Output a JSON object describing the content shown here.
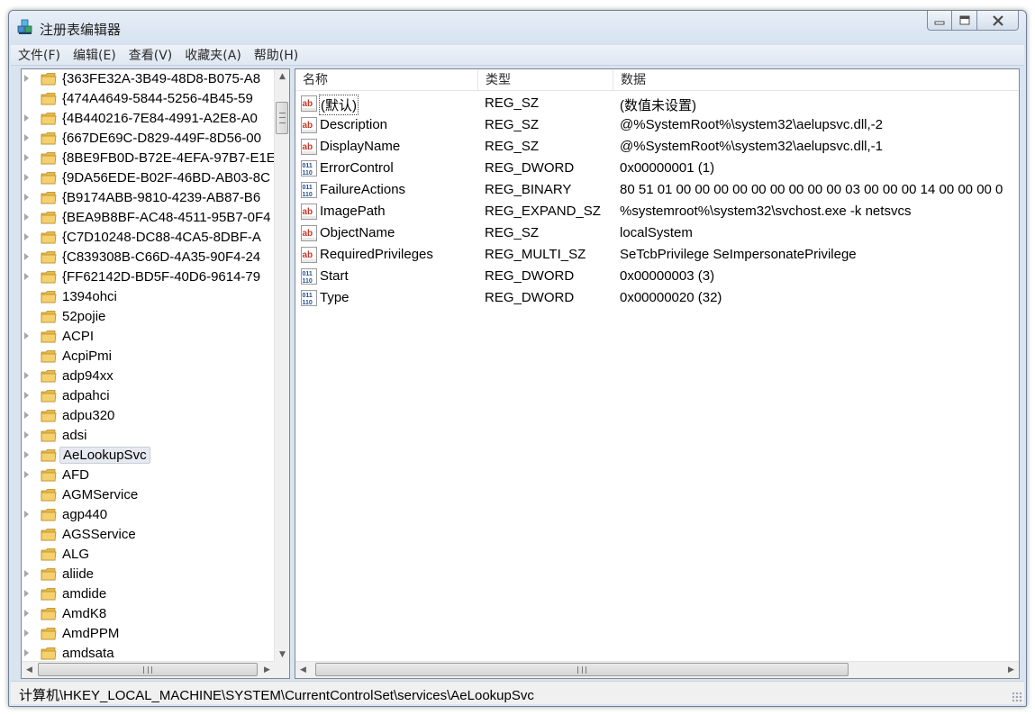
{
  "window": {
    "title": "注册表编辑器"
  },
  "caption": {
    "minimize_icon": "minimize-icon",
    "maximize_icon": "maximize-icon",
    "close_icon": "close-icon"
  },
  "menu": [
    "文件(F)",
    "编辑(E)",
    "查看(V)",
    "收藏夹(A)",
    "帮助(H)"
  ],
  "tree": {
    "items": [
      {
        "label": "{363FE32A-3B49-48D8-B075-A8",
        "expandable": true
      },
      {
        "label": "{474A4649-5844-5256-4B45-59",
        "expandable": false
      },
      {
        "label": "{4B440216-7E84-4991-A2E8-A0",
        "expandable": true
      },
      {
        "label": "{667DE69C-D829-449F-8D56-00",
        "expandable": true
      },
      {
        "label": "{8BE9FB0D-B72E-4EFA-97B7-E1E",
        "expandable": true
      },
      {
        "label": "{9DA56EDE-B02F-46BD-AB03-8C",
        "expandable": true
      },
      {
        "label": "{B9174ABB-9810-4239-AB87-B6",
        "expandable": true
      },
      {
        "label": "{BEA9B8BF-AC48-4511-95B7-0F4",
        "expandable": true
      },
      {
        "label": "{C7D10248-DC88-4CA5-8DBF-A",
        "expandable": true
      },
      {
        "label": "{C839308B-C66D-4A35-90F4-24",
        "expandable": true
      },
      {
        "label": "{FF62142D-BD5F-40D6-9614-79",
        "expandable": true
      },
      {
        "label": "1394ohci",
        "expandable": false
      },
      {
        "label": "52pojie",
        "expandable": false
      },
      {
        "label": "ACPI",
        "expandable": true
      },
      {
        "label": "AcpiPmi",
        "expandable": false
      },
      {
        "label": "adp94xx",
        "expandable": true
      },
      {
        "label": "adpahci",
        "expandable": true
      },
      {
        "label": "adpu320",
        "expandable": true
      },
      {
        "label": "adsi",
        "expandable": true
      },
      {
        "label": "AeLookupSvc",
        "expandable": true,
        "selected": true
      },
      {
        "label": "AFD",
        "expandable": true
      },
      {
        "label": "AGMService",
        "expandable": false
      },
      {
        "label": "agp440",
        "expandable": true
      },
      {
        "label": "AGSService",
        "expandable": false
      },
      {
        "label": "ALG",
        "expandable": false
      },
      {
        "label": "aliide",
        "expandable": true
      },
      {
        "label": "amdide",
        "expandable": true
      },
      {
        "label": "AmdK8",
        "expandable": true
      },
      {
        "label": "AmdPPM",
        "expandable": true
      },
      {
        "label": "amdsata",
        "expandable": true
      }
    ]
  },
  "list": {
    "columns": [
      "名称",
      "类型",
      "数据"
    ],
    "rows": [
      {
        "icon": "string-value-icon",
        "name": "(默认)",
        "type": "REG_SZ",
        "data": "(数值未设置)",
        "focused": true
      },
      {
        "icon": "string-value-icon",
        "name": "Description",
        "type": "REG_SZ",
        "data": "@%SystemRoot%\\system32\\aelupsvc.dll,-2"
      },
      {
        "icon": "string-value-icon",
        "name": "DisplayName",
        "type": "REG_SZ",
        "data": "@%SystemRoot%\\system32\\aelupsvc.dll,-1"
      },
      {
        "icon": "binary-value-icon",
        "name": "ErrorControl",
        "type": "REG_DWORD",
        "data": "0x00000001 (1)"
      },
      {
        "icon": "binary-value-icon",
        "name": "FailureActions",
        "type": "REG_BINARY",
        "data": "80 51 01 00 00 00 00 00 00 00 00 00 03 00 00 00 14 00 00 00 0"
      },
      {
        "icon": "string-value-icon",
        "name": "ImagePath",
        "type": "REG_EXPAND_SZ",
        "data": "%systemroot%\\system32\\svchost.exe -k netsvcs"
      },
      {
        "icon": "string-value-icon",
        "name": "ObjectName",
        "type": "REG_SZ",
        "data": "localSystem"
      },
      {
        "icon": "string-value-icon",
        "name": "RequiredPrivileges",
        "type": "REG_MULTI_SZ",
        "data": "SeTcbPrivilege SeImpersonatePrivilege"
      },
      {
        "icon": "binary-value-icon",
        "name": "Start",
        "type": "REG_DWORD",
        "data": "0x00000003 (3)"
      },
      {
        "icon": "binary-value-icon",
        "name": "Type",
        "type": "REG_DWORD",
        "data": "0x00000020 (32)"
      }
    ]
  },
  "statusbar": {
    "path": "计算机\\HKEY_LOCAL_MACHINE\\SYSTEM\\CurrentControlSet\\services\\AeLookupSvc"
  }
}
